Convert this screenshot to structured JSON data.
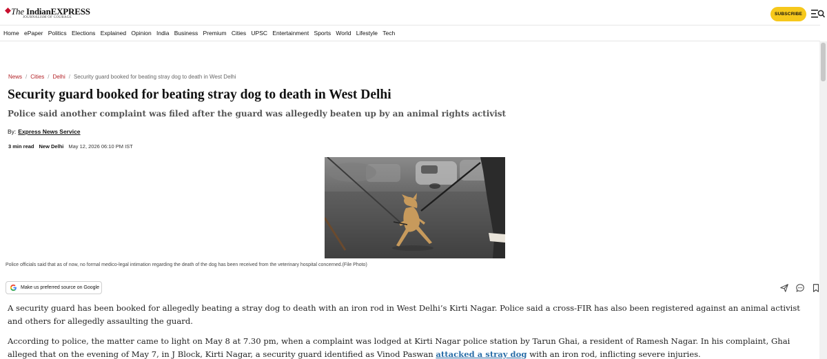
{
  "header": {
    "logo_name_italic": "The",
    "logo_name_main": "IndianEXPRESS",
    "logo_tagline": "JOURNALISM OF COURAGE",
    "subscribe_label": "SUBSCRIBE",
    "brand_red": "#c8102e",
    "subscribe_color": "#f6c81b"
  },
  "nav": {
    "items": [
      "Home",
      "ePaper",
      "Politics",
      "Elections",
      "Explained",
      "Opinion",
      "India",
      "Business",
      "Premium",
      "Cities",
      "UPSC",
      "Entertainment",
      "Sports",
      "World",
      "Lifestyle",
      "Tech"
    ]
  },
  "breadcrumb": {
    "items": [
      "News",
      "Cities",
      "Delhi"
    ],
    "separator": "/",
    "current": "Security guard booked for beating stray dog to death in West Delhi"
  },
  "article": {
    "headline": "Security guard booked for beating stray dog to death in West Delhi",
    "standfirst": "Police said another complaint was filed after the guard was allegedly beaten up by an animal rights activist",
    "byline_prefix": "By:",
    "author": "Express News Service",
    "read_time": "3 min read",
    "location": "New Delhi",
    "date": "May 12, 2026 06:10 PM IST",
    "image_caption": "Police officials said that as of now, no formal medico-legal intimation regarding the death of the dog has been received from the veterinary hospital concerned.(File Photo)",
    "source_button_label": "Make us preferred source on Google",
    "paragraph_1": "A security guard has been booked for allegedly beating a stray dog to death with an iron rod in West Delhi’s Kirti Nagar. Police said a cross-FIR has also been registered against an animal activist and others for allegedly assaulting the guard.",
    "paragraph_2_before": "According to police, the matter came to light on May 8 at 7.30 pm, when a complaint was lodged at Kirti Nagar police station by Tarun Ghai, a resident of Ramesh Nagar. In his complaint, Ghai alleged that on the evening of May 7, in J Block, Kirti Nagar, a security guard identified as Vinod Paswan ",
    "paragraph_2_link": "attacked a stray dog",
    "paragraph_2_after": " with an iron rod, inflicting severe injuries.",
    "link_color": "#2a6ea8"
  },
  "icons": {
    "menu": "hamburger-search-icon",
    "share": "send-icon",
    "comment": "comment-icon",
    "bookmark": "bookmark-icon",
    "google": "google-g-icon"
  }
}
